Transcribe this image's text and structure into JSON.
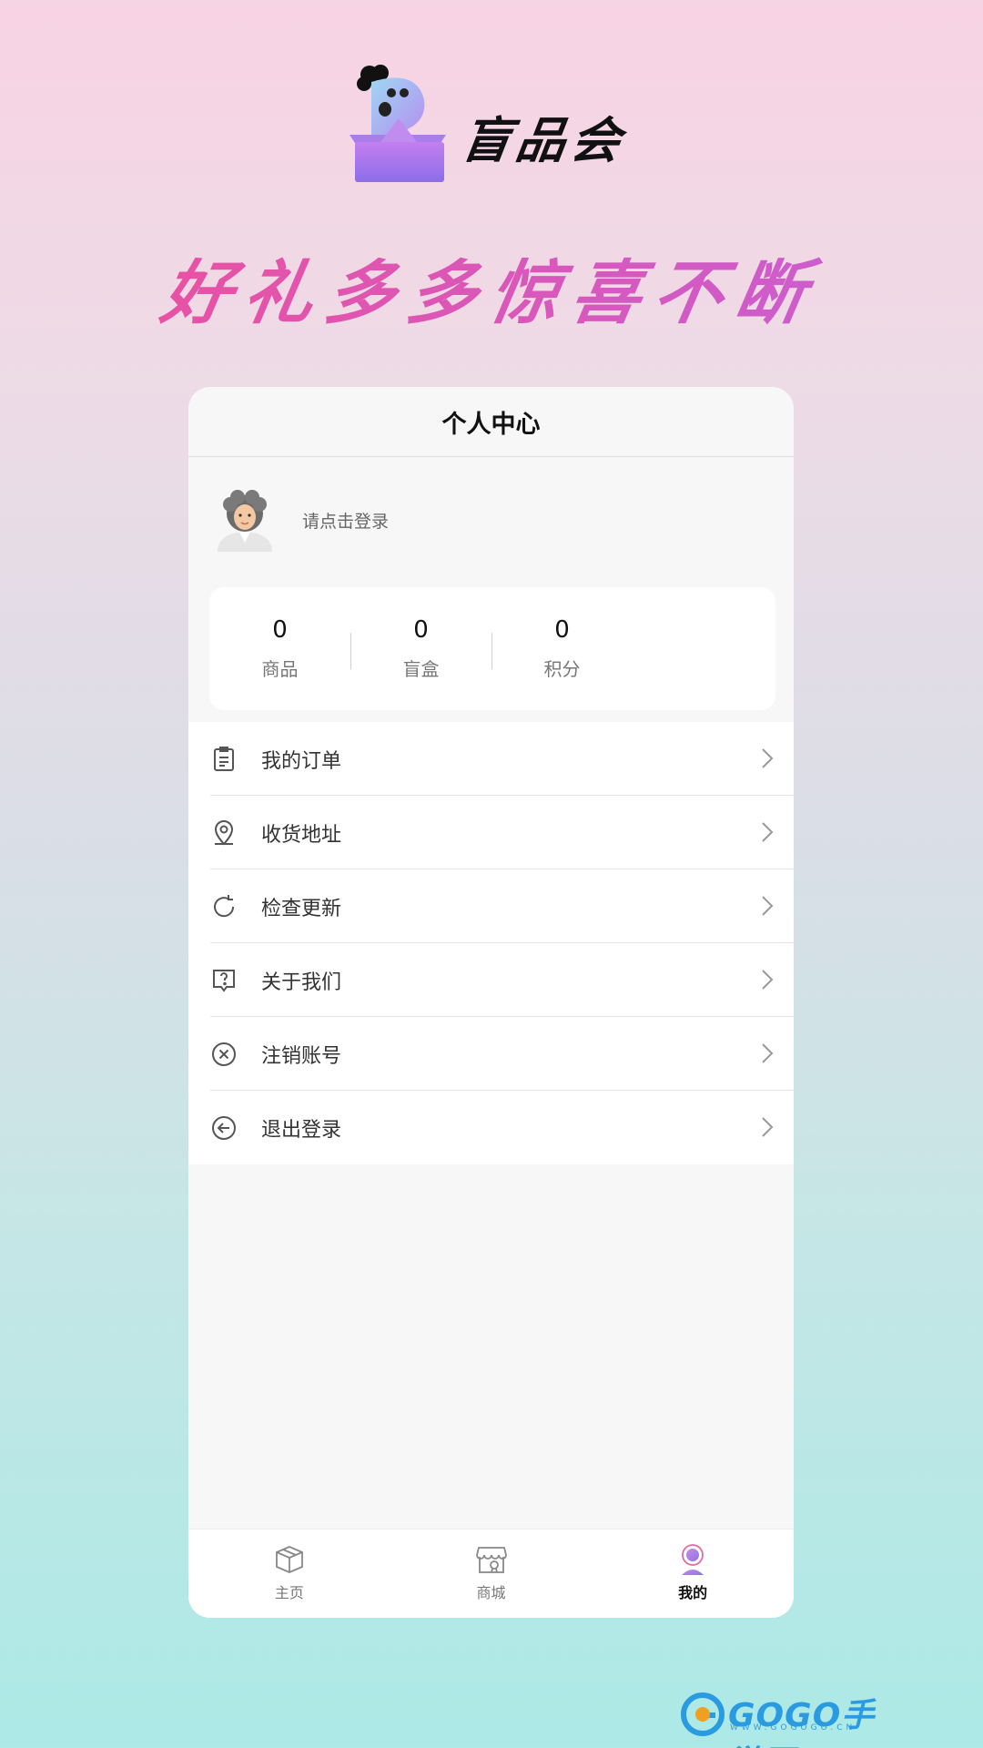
{
  "app": {
    "name": "盲品会"
  },
  "slogan": "好礼多多惊喜不断",
  "card": {
    "title": "个人中心",
    "profile": {
      "login_prompt": "请点击登录"
    },
    "stats": [
      {
        "value": "0",
        "label": "商品"
      },
      {
        "value": "0",
        "label": "盲盒"
      },
      {
        "value": "0",
        "label": "积分"
      }
    ],
    "menu": [
      {
        "label": "我的订单",
        "icon": "order-icon"
      },
      {
        "label": "收货地址",
        "icon": "location-icon"
      },
      {
        "label": "检查更新",
        "icon": "refresh-icon"
      },
      {
        "label": "关于我们",
        "icon": "help-icon"
      },
      {
        "label": "注销账号",
        "icon": "close-circle-icon"
      },
      {
        "label": "退出登录",
        "icon": "logout-icon"
      }
    ],
    "tabs": [
      {
        "label": "主页",
        "icon": "box-icon",
        "active": false
      },
      {
        "label": "商城",
        "icon": "shop-icon",
        "active": false
      },
      {
        "label": "我的",
        "icon": "profile-icon",
        "active": true
      }
    ]
  },
  "watermark": {
    "text": "GOGO手游网",
    "sub": "WWW.GOGOGO.CN"
  },
  "colors": {
    "slogan_start": "#ee4f9a",
    "slogan_end": "#c65fd6",
    "accent": "#9b6fe0"
  }
}
